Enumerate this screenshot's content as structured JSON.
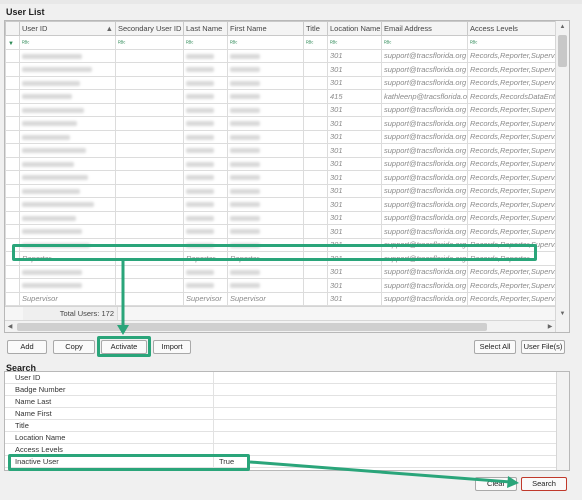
{
  "window": {
    "title_partial": "User"
  },
  "user_list": {
    "title": "User List",
    "columns": [
      "User ID",
      "Secondary User ID",
      "Last Name",
      "First Name",
      "Title",
      "Location Name",
      "Email Address",
      "Access Levels"
    ],
    "filter_icon": "filter-icon",
    "rows": [
      {
        "location": "301",
        "email": "support@tracsflorida.org",
        "access": "Records,Reporter,Supervisor"
      },
      {
        "location": "301",
        "email": "support@tracsflorida.org",
        "access": "Records,Reporter,Supervisor"
      },
      {
        "location": "301",
        "email": "support@tracsflorida.org",
        "access": "Records,Reporter,Supervisor"
      },
      {
        "location": "415",
        "email": "kathleenp@tracsflorida.org",
        "access": "Records,RecordsDataEntry,Su"
      },
      {
        "location": "301",
        "email": "support@tracsflorida.org",
        "access": "Records,Reporter,Supervisor"
      },
      {
        "location": "301",
        "email": "support@tracsflorida.org",
        "access": "Records,Reporter,Supervisor"
      },
      {
        "location": "301",
        "email": "support@tracsflorida.org",
        "access": "Records,Reporter,Supervisor"
      },
      {
        "location": "301",
        "email": "support@tracsflorida.org",
        "access": "Records,Reporter,Supervisor"
      },
      {
        "location": "301",
        "email": "support@tracsflorida.org",
        "access": "Records,Reporter,Supervisor"
      },
      {
        "location": "301",
        "email": "support@tracsflorida.org",
        "access": "Records,Reporter,Supervisor"
      },
      {
        "location": "301",
        "email": "support@tracsflorida.org",
        "access": "Records,Reporter,Supervisor"
      },
      {
        "location": "301",
        "email": "support@tracsflorida.org",
        "access": "Records,Reporter,Supervisor"
      },
      {
        "location": "301",
        "email": "support@tracsflorida.org",
        "access": "Records,Reporter,Supervisor"
      },
      {
        "location": "301",
        "email": "support@tracsflorida.org",
        "access": "Records,Reporter,Supervisor"
      },
      {
        "location": "301",
        "email": "support@tracsflorida.org",
        "access": "Records,Reporter,Supervisor"
      }
    ],
    "highlighted_row": {
      "user_id": "Reporter",
      "last_name": "Reporter",
      "first_name": "Reporter",
      "location": "301",
      "email": "support@tracsflorida.org",
      "access": "Records,Reporter"
    },
    "after_rows": [
      {
        "location": "301",
        "email": "support@tracsflorida.org",
        "access": "Records,Reporter,Supervisor"
      },
      {
        "location": "301",
        "email": "support@tracsflorida.org",
        "access": "Records,Reporter,Supervisor"
      },
      {
        "user_id": "Supervisor",
        "last_name": "Supervisor",
        "first_name": "Supervisor",
        "location": "301",
        "email": "support@tracsflorida.org",
        "access": "Records,Reporter,Supervisor"
      }
    ],
    "total_label": "Total Users: 172"
  },
  "buttons": {
    "add": "Add",
    "copy": "Copy",
    "activate": "Activate",
    "import": "Import",
    "select_all": "Select All",
    "user_files": "User File(s)",
    "clear": "Clear",
    "search": "Search"
  },
  "search": {
    "title": "Search",
    "fields": [
      {
        "label": "User ID",
        "value": ""
      },
      {
        "label": "Badge Number",
        "value": ""
      },
      {
        "label": "Name Last",
        "value": ""
      },
      {
        "label": "Name First",
        "value": ""
      },
      {
        "label": "Title",
        "value": ""
      },
      {
        "label": "Location Name",
        "value": ""
      },
      {
        "label": "Access Levels",
        "value": ""
      },
      {
        "label": "Inactive User",
        "value": "True"
      }
    ]
  },
  "colors": {
    "highlight": "#2aa57a",
    "search_button_border": "#c0392b"
  }
}
